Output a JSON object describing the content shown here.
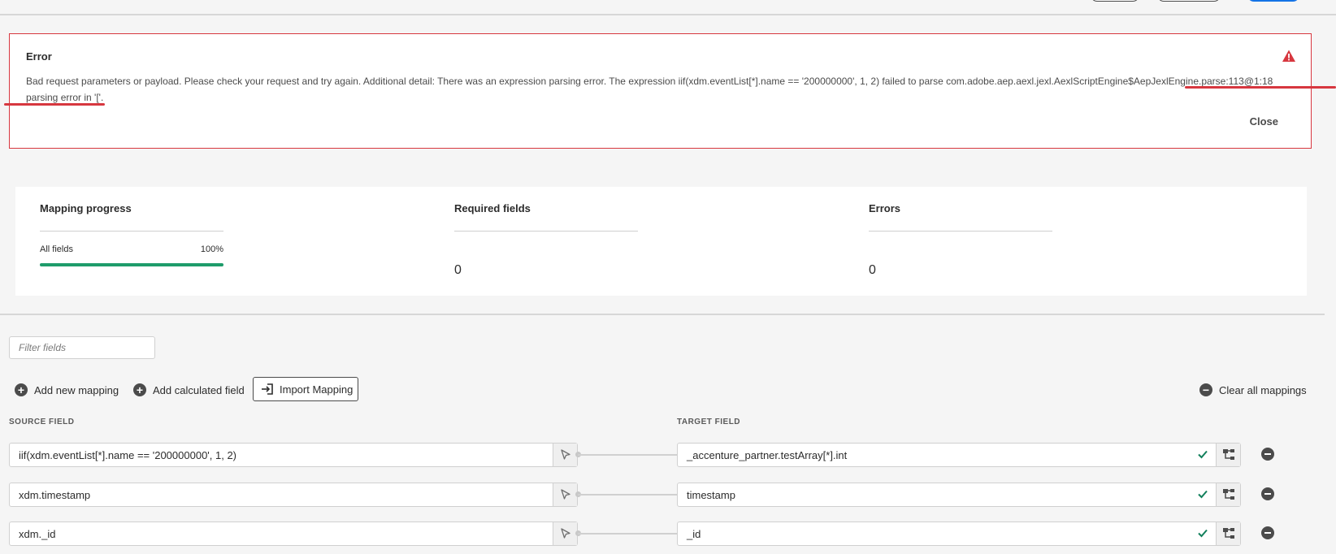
{
  "error": {
    "title": "Error",
    "message": "Bad request parameters or payload. Please check your request and try again. Additional detail: There was an expression parsing error. The expression iif(xdm.eventList[*].name == '200000000', 1, 2) failed to parse com.adobe.aep.aexl.jexl.AexlScriptEngine$AepJexlEngine.parse:113@1:18 parsing error in '['.",
    "close_label": "Close",
    "icon": "alert-triangle-icon",
    "color": "#d7373f"
  },
  "progress": {
    "mapping": {
      "title": "Mapping progress",
      "row_label": "All fields",
      "row_value": "100%",
      "fill": 1.0,
      "bar_color": "#1e9c6b"
    },
    "required": {
      "title": "Required fields",
      "value": "0"
    },
    "errors": {
      "title": "Errors",
      "value": "0"
    }
  },
  "filter": {
    "placeholder": "Filter fields"
  },
  "actions": {
    "add_mapping": "Add new mapping",
    "add_calculated": "Add calculated field",
    "import_mapping": "Import Mapping",
    "clear_all": "Clear all mappings"
  },
  "columns": {
    "source": "SOURCE FIELD",
    "target": "TARGET FIELD"
  },
  "mappings": [
    {
      "source": "iif(xdm.eventList[*].name == '200000000', 1, 2)",
      "target": "_accenture_partner.testArray[*].int"
    },
    {
      "source": "xdm.timestamp",
      "target": "timestamp"
    },
    {
      "source": "xdm._id",
      "target": "_id"
    }
  ],
  "colors": {
    "accent": "#1473e6",
    "success": "#12805c",
    "error": "#d7373f"
  }
}
